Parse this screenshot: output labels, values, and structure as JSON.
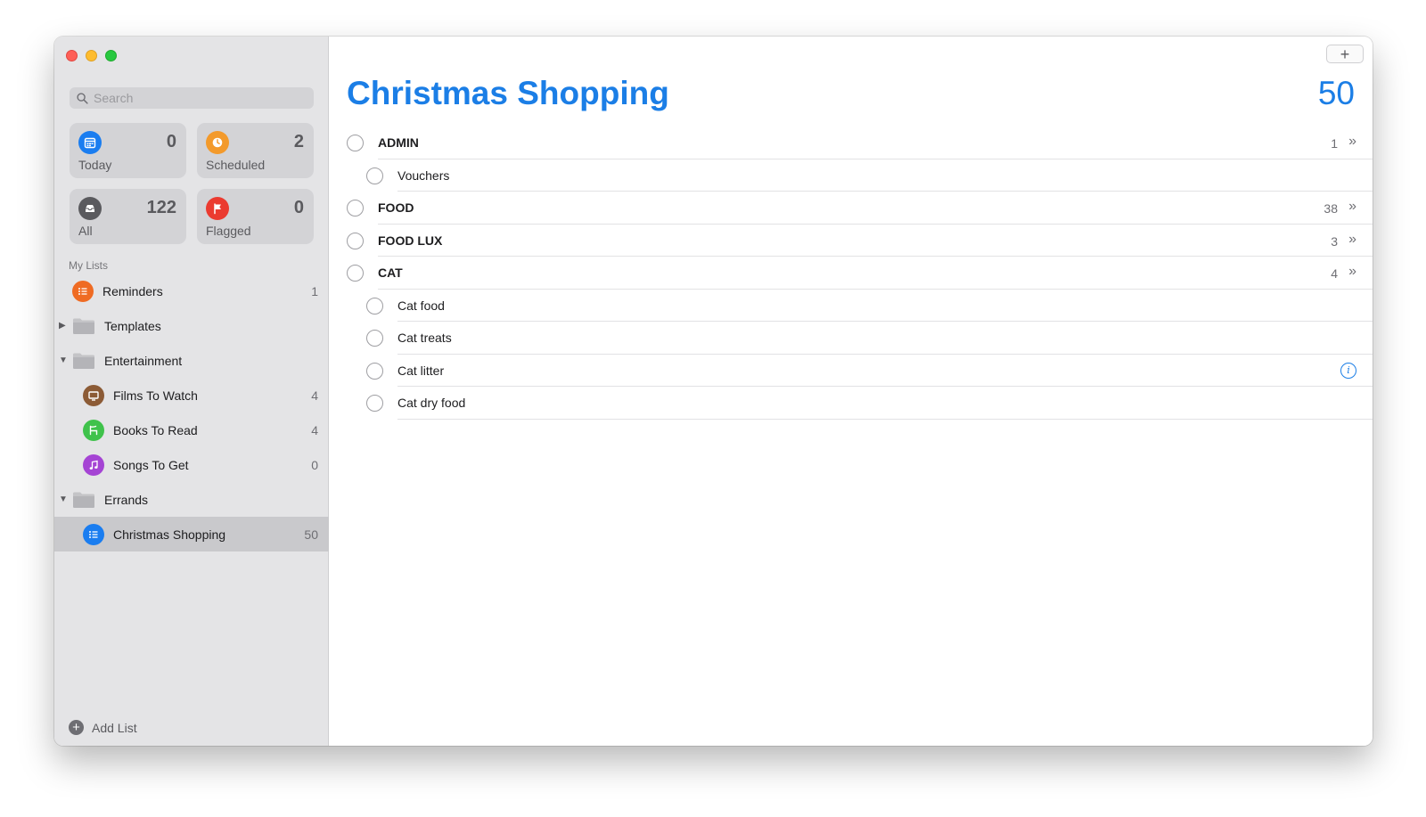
{
  "search": {
    "placeholder": "Search"
  },
  "smart_lists": [
    {
      "label": "Today",
      "count": "0",
      "icon": "calendar-icon",
      "color": "#1a7df0"
    },
    {
      "label": "Scheduled",
      "count": "2",
      "icon": "clock-icon",
      "color": "#f39a2b"
    },
    {
      "label": "All",
      "count": "122",
      "icon": "tray-icon",
      "color": "#5a5a5e"
    },
    {
      "label": "Flagged",
      "count": "0",
      "icon": "flag-icon",
      "color": "#eb3b30"
    }
  ],
  "sidebar": {
    "section_title": "My Lists",
    "items": [
      {
        "label": "Reminders",
        "count": "1"
      },
      {
        "label": "Templates"
      },
      {
        "label": "Entertainment"
      },
      {
        "label": "Films To Watch",
        "count": "4"
      },
      {
        "label": "Books To Read",
        "count": "4"
      },
      {
        "label": "Songs To Get",
        "count": "0"
      },
      {
        "label": "Errands"
      },
      {
        "label": "Christmas Shopping",
        "count": "50"
      }
    ],
    "add_list_label": "Add List"
  },
  "main": {
    "title": "Christmas Shopping",
    "count": "50",
    "accent_color": "#1b7ee6",
    "rows": [
      {
        "label": "ADMIN",
        "count": "1"
      },
      {
        "label": "Vouchers"
      },
      {
        "label": "FOOD",
        "count": "38"
      },
      {
        "label": "FOOD LUX",
        "count": "3"
      },
      {
        "label": "CAT",
        "count": "4"
      },
      {
        "label": "Cat food"
      },
      {
        "label": "Cat treats"
      },
      {
        "label": "Cat litter"
      },
      {
        "label": "Cat dry food"
      }
    ]
  }
}
